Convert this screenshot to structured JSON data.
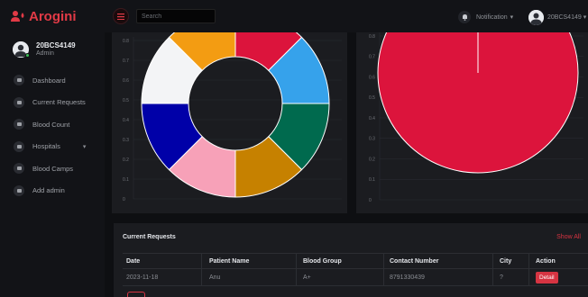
{
  "brand": {
    "name": "Arogini"
  },
  "search": {
    "placeholder": "Search"
  },
  "header": {
    "notification_label": "Notification",
    "user": "20BCS4149"
  },
  "profile": {
    "id": "20BCS4149",
    "role": "Admin"
  },
  "sidebar": {
    "items": [
      {
        "label": "Dashboard",
        "icon": "dashboard-icon"
      },
      {
        "label": "Current Requests",
        "icon": "monitor-icon"
      },
      {
        "label": "Blood Count",
        "icon": "grid-icon"
      },
      {
        "label": "Hospitals",
        "icon": "hospital-icon",
        "has_submenu": true
      },
      {
        "label": "Blood Camps",
        "icon": "calendar-icon"
      },
      {
        "label": "Add admin",
        "icon": "admin-icon"
      }
    ]
  },
  "colors": {
    "accent": "#d63442",
    "panel": "#1b1c20",
    "background": "#0e0f12"
  },
  "chart_data": [
    {
      "type": "pie",
      "variant": "doughnut",
      "slices": [
        {
          "color": "#dc143c",
          "value": 1
        },
        {
          "color": "#36a2eb",
          "value": 1
        },
        {
          "color": "#006a4e",
          "value": 1
        },
        {
          "color": "#c68100",
          "value": 1
        },
        {
          "color": "#f7a1b8",
          "value": 1
        },
        {
          "color": "#0000a8",
          "value": 1
        },
        {
          "color": "#f3f4f6",
          "value": 1
        },
        {
          "color": "#f39c12",
          "value": 1
        }
      ],
      "grid": true,
      "y_ticks": [
        "0.8",
        "0.7",
        "0.6",
        "0.5",
        "0.4",
        "0.3",
        "0.2",
        "0.1",
        "0"
      ]
    },
    {
      "type": "pie",
      "slices": [
        {
          "color": "#dc143c",
          "value": 1
        }
      ],
      "grid": true,
      "y_ticks": [
        "0.8",
        "0.7",
        "0.6",
        "0.5",
        "0.4",
        "0.3",
        "0.2",
        "0.1",
        "0"
      ]
    }
  ],
  "requests": {
    "title": "Current Requests",
    "show_all": "Show All",
    "columns": [
      "Date",
      "Patient Name",
      "Blood Group",
      "Contact Number",
      "City",
      "Action"
    ],
    "rows": [
      {
        "date": "2023-11-18",
        "patient": "Anu",
        "blood_group": "A+",
        "contact": "8791330439",
        "city": "?",
        "action": "Detail"
      }
    ]
  }
}
